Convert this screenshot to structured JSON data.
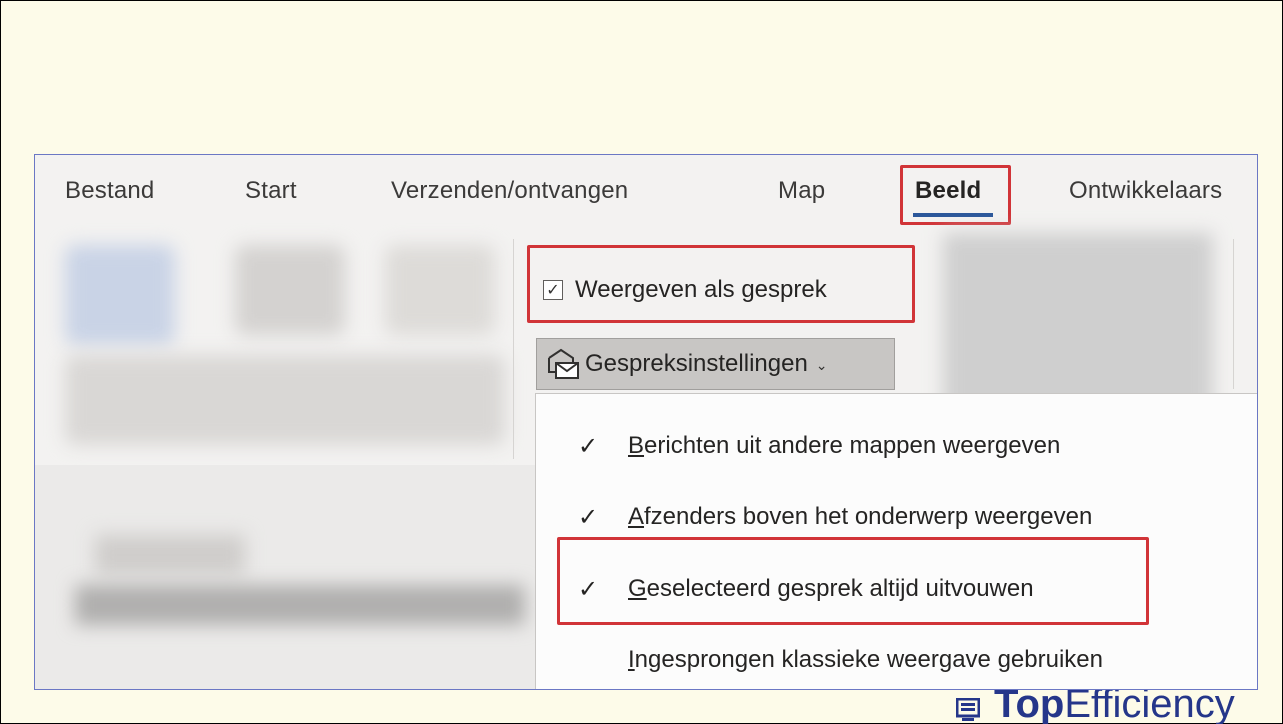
{
  "ribbon": {
    "tabs": [
      {
        "label": "Bestand"
      },
      {
        "label": "Start"
      },
      {
        "label": "Verzenden/ontvangen"
      },
      {
        "label": "Map"
      },
      {
        "label": "Beeld"
      },
      {
        "label": "Ontwikkelaars"
      }
    ],
    "active_tab": "Beeld",
    "accent_color": "#2b579a"
  },
  "conversation": {
    "show_as_conversation": {
      "label": "Weergeven als gesprek",
      "checked": true
    },
    "settings_button": {
      "label": "Gespreksinstellingen",
      "icon": "conversation-settings-icon"
    }
  },
  "menu": {
    "items": [
      {
        "access_key": "B",
        "rest": "erichten uit andere mappen weergeven",
        "checked": true
      },
      {
        "access_key": "A",
        "rest": "fzenders boven het onderwerp weergeven",
        "checked": true
      },
      {
        "access_key": "G",
        "rest": "eselecteerd gesprek altijd uitvouwen",
        "checked": true
      },
      {
        "access_key": "I",
        "rest": "ngesprongen klassieke weergave gebruiken",
        "checked": false
      }
    ]
  },
  "highlight_color": "#d13438",
  "watermark": {
    "part1": "Top",
    "part2": "Efficiency"
  }
}
